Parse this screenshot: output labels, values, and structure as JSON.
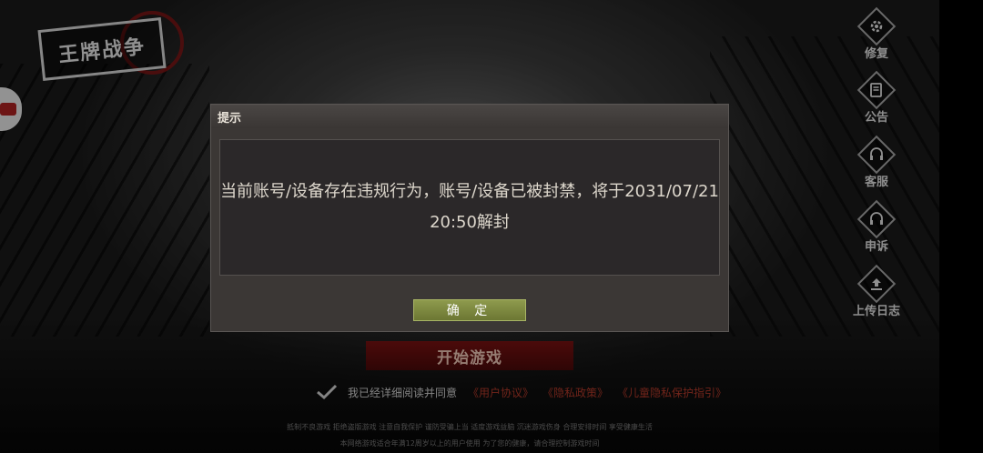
{
  "logo": {
    "text": "王牌战争"
  },
  "side_menu": [
    {
      "label": "修复",
      "icon": "gear-icon"
    },
    {
      "label": "公告",
      "icon": "announcement-icon"
    },
    {
      "label": "客服",
      "icon": "headset-icon"
    },
    {
      "label": "申诉",
      "icon": "headset-icon"
    },
    {
      "label": "上传日志",
      "icon": "upload-icon"
    }
  ],
  "start_button": "开始游戏",
  "agreement": {
    "text": "我已经详细阅读并同意",
    "links": [
      "《用户协议》",
      "《隐私政策》",
      "《儿童隐私保护指引》"
    ]
  },
  "notice": {
    "line1": "抵制不良游戏  拒绝盗版游戏  注意自我保护  谨防受骗上当  适度游戏益脑  沉迷游戏伤身  合理安排时间  享受健康生活",
    "line2": "本网络游戏适合年满12周岁以上的用户使用    为了您的健康，请合理控制游戏时间"
  },
  "dialog": {
    "title": "提示",
    "message": "当前账号/设备存在违规行为，账号/设备已被封禁，将于2031/07/21 20:50解封",
    "confirm": "确 定"
  },
  "colors": {
    "confirm_button": "#7a8640",
    "start_button": "#6a1010",
    "agreement_link": "#b63a2a",
    "dialog_bg": "#3b3735"
  }
}
